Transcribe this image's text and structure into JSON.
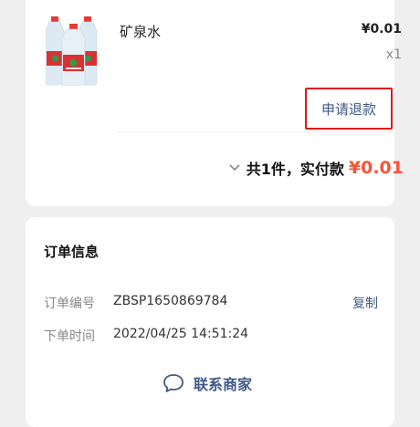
{
  "product": {
    "image_icon": "water-bottles-image",
    "name": "矿泉水",
    "price": "¥0.01",
    "quantity": "x1",
    "refund_label": "申请退款"
  },
  "summary": {
    "count_text": "共1件，实付款",
    "total": "¥0.01"
  },
  "order_info": {
    "title": "订单信息",
    "order_number_label": "订单编号",
    "order_number": "ZBSP1650869784",
    "copy_label": "复制",
    "order_time_label": "下单时间",
    "order_time": "2022/04/25 14:51:24",
    "contact_label": "联系商家",
    "contact_icon": "chat-bubble-icon"
  },
  "colors": {
    "accent_blue": "#3f5a85",
    "price_red": "#f5553a",
    "highlight_border": "#e01818"
  }
}
